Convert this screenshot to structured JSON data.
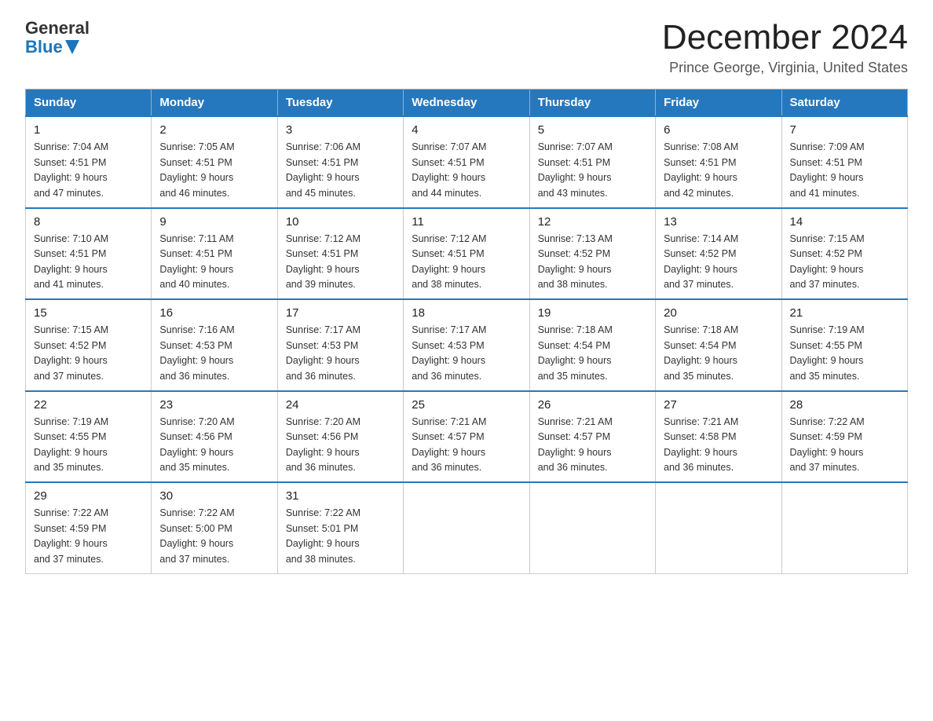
{
  "header": {
    "logo_general": "General",
    "logo_blue": "Blue",
    "title": "December 2024",
    "location": "Prince George, Virginia, United States"
  },
  "weekdays": [
    "Sunday",
    "Monday",
    "Tuesday",
    "Wednesday",
    "Thursday",
    "Friday",
    "Saturday"
  ],
  "weeks": [
    [
      {
        "day": "1",
        "sunrise": "7:04 AM",
        "sunset": "4:51 PM",
        "daylight": "9 hours and 47 minutes."
      },
      {
        "day": "2",
        "sunrise": "7:05 AM",
        "sunset": "4:51 PM",
        "daylight": "9 hours and 46 minutes."
      },
      {
        "day": "3",
        "sunrise": "7:06 AM",
        "sunset": "4:51 PM",
        "daylight": "9 hours and 45 minutes."
      },
      {
        "day": "4",
        "sunrise": "7:07 AM",
        "sunset": "4:51 PM",
        "daylight": "9 hours and 44 minutes."
      },
      {
        "day": "5",
        "sunrise": "7:07 AM",
        "sunset": "4:51 PM",
        "daylight": "9 hours and 43 minutes."
      },
      {
        "day": "6",
        "sunrise": "7:08 AM",
        "sunset": "4:51 PM",
        "daylight": "9 hours and 42 minutes."
      },
      {
        "day": "7",
        "sunrise": "7:09 AM",
        "sunset": "4:51 PM",
        "daylight": "9 hours and 41 minutes."
      }
    ],
    [
      {
        "day": "8",
        "sunrise": "7:10 AM",
        "sunset": "4:51 PM",
        "daylight": "9 hours and 41 minutes."
      },
      {
        "day": "9",
        "sunrise": "7:11 AM",
        "sunset": "4:51 PM",
        "daylight": "9 hours and 40 minutes."
      },
      {
        "day": "10",
        "sunrise": "7:12 AM",
        "sunset": "4:51 PM",
        "daylight": "9 hours and 39 minutes."
      },
      {
        "day": "11",
        "sunrise": "7:12 AM",
        "sunset": "4:51 PM",
        "daylight": "9 hours and 38 minutes."
      },
      {
        "day": "12",
        "sunrise": "7:13 AM",
        "sunset": "4:52 PM",
        "daylight": "9 hours and 38 minutes."
      },
      {
        "day": "13",
        "sunrise": "7:14 AM",
        "sunset": "4:52 PM",
        "daylight": "9 hours and 37 minutes."
      },
      {
        "day": "14",
        "sunrise": "7:15 AM",
        "sunset": "4:52 PM",
        "daylight": "9 hours and 37 minutes."
      }
    ],
    [
      {
        "day": "15",
        "sunrise": "7:15 AM",
        "sunset": "4:52 PM",
        "daylight": "9 hours and 37 minutes."
      },
      {
        "day": "16",
        "sunrise": "7:16 AM",
        "sunset": "4:53 PM",
        "daylight": "9 hours and 36 minutes."
      },
      {
        "day": "17",
        "sunrise": "7:17 AM",
        "sunset": "4:53 PM",
        "daylight": "9 hours and 36 minutes."
      },
      {
        "day": "18",
        "sunrise": "7:17 AM",
        "sunset": "4:53 PM",
        "daylight": "9 hours and 36 minutes."
      },
      {
        "day": "19",
        "sunrise": "7:18 AM",
        "sunset": "4:54 PM",
        "daylight": "9 hours and 35 minutes."
      },
      {
        "day": "20",
        "sunrise": "7:18 AM",
        "sunset": "4:54 PM",
        "daylight": "9 hours and 35 minutes."
      },
      {
        "day": "21",
        "sunrise": "7:19 AM",
        "sunset": "4:55 PM",
        "daylight": "9 hours and 35 minutes."
      }
    ],
    [
      {
        "day": "22",
        "sunrise": "7:19 AM",
        "sunset": "4:55 PM",
        "daylight": "9 hours and 35 minutes."
      },
      {
        "day": "23",
        "sunrise": "7:20 AM",
        "sunset": "4:56 PM",
        "daylight": "9 hours and 35 minutes."
      },
      {
        "day": "24",
        "sunrise": "7:20 AM",
        "sunset": "4:56 PM",
        "daylight": "9 hours and 36 minutes."
      },
      {
        "day": "25",
        "sunrise": "7:21 AM",
        "sunset": "4:57 PM",
        "daylight": "9 hours and 36 minutes."
      },
      {
        "day": "26",
        "sunrise": "7:21 AM",
        "sunset": "4:57 PM",
        "daylight": "9 hours and 36 minutes."
      },
      {
        "day": "27",
        "sunrise": "7:21 AM",
        "sunset": "4:58 PM",
        "daylight": "9 hours and 36 minutes."
      },
      {
        "day": "28",
        "sunrise": "7:22 AM",
        "sunset": "4:59 PM",
        "daylight": "9 hours and 37 minutes."
      }
    ],
    [
      {
        "day": "29",
        "sunrise": "7:22 AM",
        "sunset": "4:59 PM",
        "daylight": "9 hours and 37 minutes."
      },
      {
        "day": "30",
        "sunrise": "7:22 AM",
        "sunset": "5:00 PM",
        "daylight": "9 hours and 37 minutes."
      },
      {
        "day": "31",
        "sunrise": "7:22 AM",
        "sunset": "5:01 PM",
        "daylight": "9 hours and 38 minutes."
      },
      null,
      null,
      null,
      null
    ]
  ],
  "labels": {
    "sunrise": "Sunrise:",
    "sunset": "Sunset:",
    "daylight": "Daylight:"
  }
}
